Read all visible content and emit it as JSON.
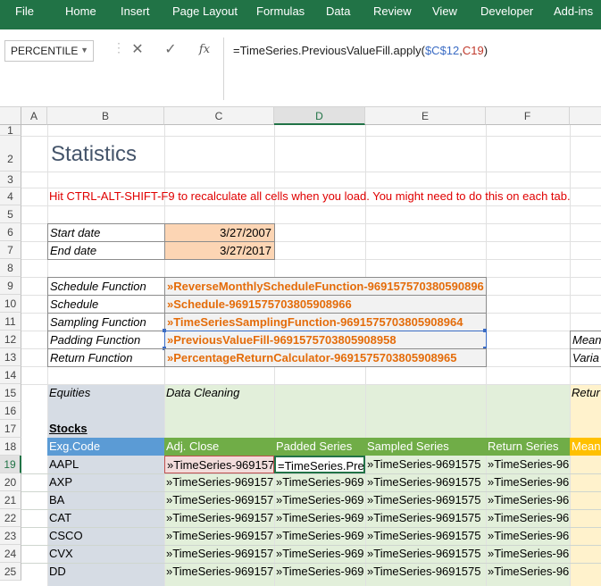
{
  "ribbon": {
    "tabs": [
      "File",
      "Home",
      "Insert",
      "Page Layout",
      "Formulas",
      "Data",
      "Review",
      "View",
      "Developer",
      "Add-ins"
    ]
  },
  "formula_bar": {
    "name_box": "PERCENTILE",
    "cancel_icon": "close-icon",
    "enter_icon": "check-icon",
    "fx_label": "fx",
    "formula_prefix": "=TimeSeries.PreviousValueFill.apply(",
    "formula_ref1": "$C$12",
    "formula_comma": ",",
    "formula_ref2": "C19",
    "formula_suffix": ")"
  },
  "columns": [
    "A",
    "B",
    "C",
    "D",
    "E",
    "F"
  ],
  "rows": [
    "1",
    "2",
    "3",
    "4",
    "5",
    "6",
    "7",
    "8",
    "9",
    "10",
    "11",
    "12",
    "13",
    "14",
    "15",
    "16",
    "17",
    "18",
    "19",
    "20",
    "21",
    "22",
    "23",
    "24",
    "25"
  ],
  "sheet": {
    "title": "Statistics",
    "instruction": "Hit CTRL-ALT-SHIFT-F9 to recalculate all cells when you load.  You might need to do this on each tab.",
    "start_date_label": "Start date",
    "start_date_value": "3/27/2007",
    "end_date_label": "End date",
    "end_date_value": "3/27/2017",
    "functions": [
      {
        "label": "Schedule Function",
        "value": "»ReverseMonthlyScheduleFunction-969157570380590896"
      },
      {
        "label": "Schedule",
        "value": "»Schedule-9691575703805908966"
      },
      {
        "label": "Sampling Function",
        "value": "»TimeSeriesSamplingFunction-9691575703805908964"
      },
      {
        "label": "Padding Function",
        "value": "»PreviousValueFill-9691575703805908958"
      },
      {
        "label": "Return Function",
        "value": "»PercentageReturnCalculator-9691575703805908965"
      }
    ],
    "side_labels": {
      "mean": "Mean",
      "variance": "Varia"
    },
    "equities_label": "Equities",
    "data_cleaning_label": "Data Cleaning",
    "returns_label": "Retur",
    "stocks_label": "Stocks",
    "headers": [
      "Exg.Code",
      "Adj. Close",
      "Padded Series",
      "Sampled Series",
      "Return Series",
      "Mean"
    ],
    "stocks": [
      {
        "code": "AAPL",
        "adj": "»TimeSeries-969157",
        "pad": "=TimeSeries.Pre",
        "samp": "»TimeSeries-9691575",
        "ret": "»TimeSeries-96"
      },
      {
        "code": "AXP",
        "adj": "»TimeSeries-969157",
        "pad": "»TimeSeries-969",
        "samp": "»TimeSeries-9691575",
        "ret": "»TimeSeries-96"
      },
      {
        "code": "BA",
        "adj": "»TimeSeries-969157",
        "pad": "»TimeSeries-969",
        "samp": "»TimeSeries-9691575",
        "ret": "»TimeSeries-96"
      },
      {
        "code": "CAT",
        "adj": "»TimeSeries-969157",
        "pad": "»TimeSeries-969",
        "samp": "»TimeSeries-9691575",
        "ret": "»TimeSeries-96"
      },
      {
        "code": "CSCO",
        "adj": "»TimeSeries-969157",
        "pad": "»TimeSeries-969",
        "samp": "»TimeSeries-9691575",
        "ret": "»TimeSeries-96"
      },
      {
        "code": "CVX",
        "adj": "»TimeSeries-969157",
        "pad": "»TimeSeries-969",
        "samp": "»TimeSeries-9691575",
        "ret": "»TimeSeries-96"
      },
      {
        "code": "DD",
        "adj": "»TimeSeries-969157",
        "pad": "»TimeSeries-969",
        "samp": "»TimeSeries-9691575",
        "ret": "»TimeSeries-96"
      }
    ]
  },
  "colors": {
    "ribbon": "#217346",
    "input_fill": "#fcd5b4",
    "equities_fill": "#d6dce4",
    "cleaning_fill": "#e2efda",
    "header_blue": "#5b9bd5",
    "header_green": "#70ad47",
    "returns_fill": "#fff2cc",
    "mean_header": "#ffc000",
    "function_text": "#e46c0a",
    "instruction_text": "#e00000"
  }
}
